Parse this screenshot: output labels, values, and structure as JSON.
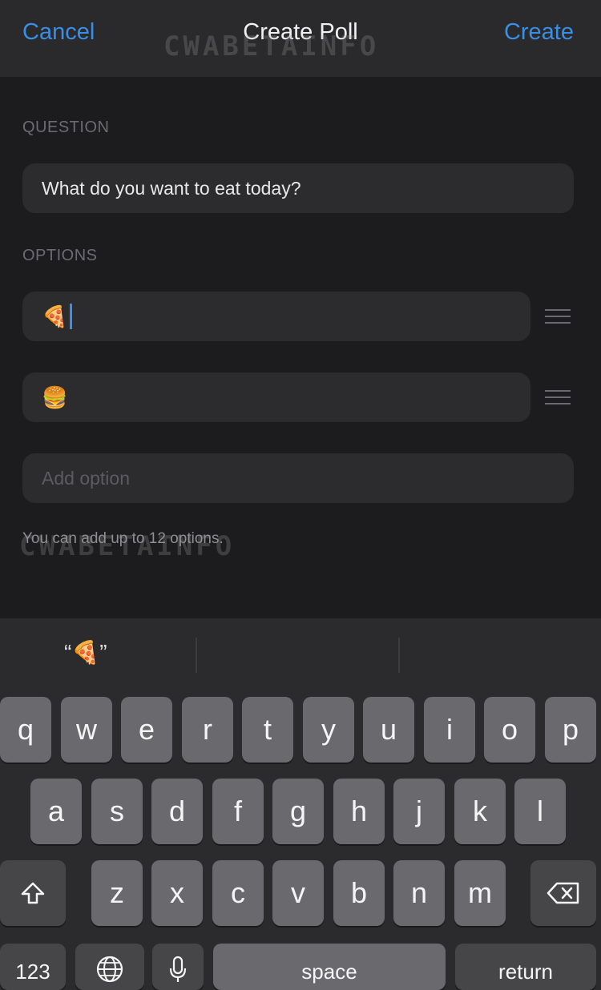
{
  "nav": {
    "cancel": "Cancel",
    "title": "Create Poll",
    "create": "Create",
    "watermark": "CWABETAINFO"
  },
  "question": {
    "label": "QUESTION",
    "value": "What do you want to eat today?"
  },
  "options": {
    "label": "OPTIONS",
    "items": [
      {
        "value": "🍕"
      },
      {
        "value": "🍔"
      }
    ],
    "add_placeholder": "Add option",
    "hint": "You can add up to 12 options."
  },
  "keyboard": {
    "suggestion": "“🍕”",
    "row1": [
      "q",
      "w",
      "e",
      "r",
      "t",
      "y",
      "u",
      "i",
      "o",
      "p"
    ],
    "row2": [
      "a",
      "s",
      "d",
      "f",
      "g",
      "h",
      "j",
      "k",
      "l"
    ],
    "row3": [
      "z",
      "x",
      "c",
      "v",
      "b",
      "n",
      "m"
    ],
    "numbers": "123",
    "space": "space",
    "return": "return",
    "shift_icon": "shift-icon",
    "delete_icon": "delete-icon",
    "globe_icon": "globe-icon",
    "mic_icon": "microphone-icon"
  },
  "colors": {
    "accent": "#3a8ee6",
    "background": "#1c1c1e",
    "field": "#2c2c2e",
    "key": "#6a6a6e"
  }
}
